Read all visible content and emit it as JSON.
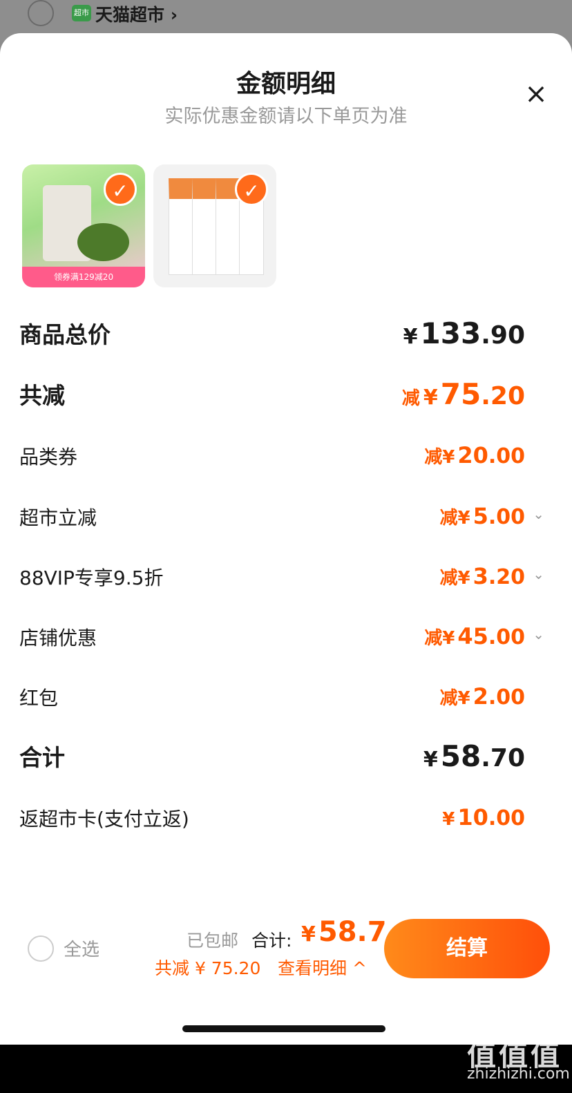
{
  "topbar": {
    "store_name": "天猫超市 ›",
    "store_icon_text": "超市"
  },
  "sheet": {
    "title": "金额明细",
    "subtitle": "实际优惠金额请以下单页为准",
    "close_icon": "×"
  },
  "products": [
    {
      "check": "✓",
      "banner": "领券满129减20"
    },
    {
      "check": "✓"
    }
  ],
  "breakdown": {
    "goods_total": {
      "label": "商品总价",
      "yen": "¥",
      "int": "133",
      "dec": ".90"
    },
    "total_discount": {
      "label": "共减",
      "prefix": "减",
      "yen": "¥",
      "int": "75",
      "dec": ".20"
    },
    "items": [
      {
        "label": "品类券",
        "prefix": "减",
        "yen": "¥",
        "int": "20",
        "dec": ".00",
        "chevron": ""
      },
      {
        "label": "超市立减",
        "prefix": "减",
        "yen": "¥",
        "int": "5",
        "dec": ".00",
        "chevron": "⌄"
      },
      {
        "label": "88VIP专享9.5折",
        "prefix": "减",
        "yen": "¥",
        "int": "3",
        "dec": ".20",
        "chevron": "⌄"
      },
      {
        "label": "店铺优惠",
        "prefix": "减",
        "yen": "¥",
        "int": "45",
        "dec": ".00",
        "chevron": "⌄"
      },
      {
        "label": "红包",
        "prefix": "减",
        "yen": "¥",
        "int": "2",
        "dec": ".00",
        "chevron": ""
      }
    ],
    "sum": {
      "label": "合计",
      "yen": "¥",
      "int": "58",
      "dec": ".70"
    },
    "cashback": {
      "label": "返超市卡(支付立返)",
      "yen": "¥",
      "int": "10",
      "dec": ".00"
    }
  },
  "footer": {
    "select_all": "全选",
    "shipping": "已包邮",
    "total_label": "合计:",
    "total_yen": "¥",
    "total_value": "58.7",
    "saving": "共减 ¥ 75.20",
    "detail_link": "查看明细 ^",
    "checkout": "结算"
  },
  "watermark": {
    "logo": "值值值",
    "text": "zhizhizhi.com"
  },
  "colors": {
    "accent": "#ff5a00",
    "checkout_start": "#ff8a1a",
    "checkout_end": "#ff4f0a"
  }
}
